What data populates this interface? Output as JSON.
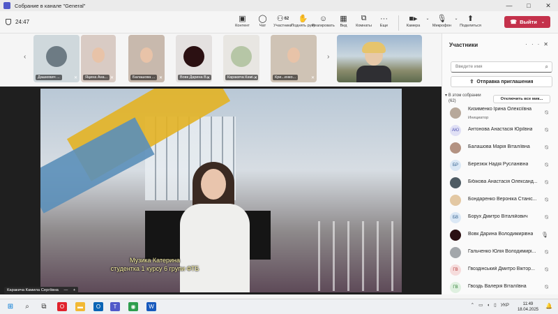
{
  "window": {
    "title": "Собрание в канале \"General\"",
    "controls": [
      "—",
      "□",
      "✕"
    ]
  },
  "toolbar": {
    "timer": "24:47",
    "buttons": [
      {
        "label": "Контент",
        "icon": "share-content-icon"
      },
      {
        "label": "Чат",
        "icon": "chat-icon"
      },
      {
        "label": "Участники",
        "icon": "participants-icon",
        "count": "62"
      },
      {
        "label": "Поднять руку",
        "icon": "raise-hand-icon"
      },
      {
        "label": "Реагировать",
        "icon": "react-icon"
      },
      {
        "label": "Вид",
        "icon": "view-icon"
      },
      {
        "label": "Комнаты",
        "icon": "rooms-icon"
      },
      {
        "label": "Еще",
        "icon": "more-icon"
      }
    ],
    "devices": [
      {
        "label": "Камера",
        "icon": "camera-icon"
      },
      {
        "label": "Микрофон",
        "icon": "microphone-off-icon"
      },
      {
        "label": "Поделиться",
        "icon": "share-icon"
      }
    ],
    "leave_label": "Выйти"
  },
  "strip": {
    "tiles": [
      {
        "name": "Дашкевич ...",
        "bg": "#cfd8dc",
        "circle": "#6d7b84"
      },
      {
        "name": "Яцина Ана...",
        "bg": "#d9cbc4",
        "circle": ""
      },
      {
        "name": "Балашова ...",
        "bg": "#c8b9ad",
        "circle": ""
      },
      {
        "name": "Вовк Дарина В...",
        "bg": "#e4e1e0",
        "circle": "#2b1012"
      },
      {
        "name": "Каракича Камі...",
        "bg": "#e8e6e2",
        "circle": "#b6c6a6"
      },
      {
        "name": "Кри...енко...",
        "bg": "#cfc3b5",
        "circle": ""
      }
    ]
  },
  "stage": {
    "caption_line1": "Музика Катерина",
    "caption_line2": "студентка 1 курсу 6 групи ФТБ",
    "speaker": "Каракича Камила Сергіївна"
  },
  "panel": {
    "title": "Участники",
    "search_placeholder": "Введите имя",
    "invite_label": "Отправка приглашения",
    "section_line1": "В этом собрании",
    "section_line2": "(62)",
    "mute_all": "Отключить все мик...",
    "participants": [
      {
        "name": "Кизименко Ірина Олексіївна",
        "role": "Инициатор",
        "initials": "",
        "av_bg": "#b7a89a",
        "av_fg": "#333",
        "mic": "off"
      },
      {
        "name": "Антонова Анастасія Юріївна",
        "role": "",
        "initials": "АЮ",
        "av_bg": "#e0e0f5",
        "av_fg": "#4f52b2",
        "mic": "off"
      },
      {
        "name": "Балашова Марія Віталіївна",
        "role": "",
        "initials": "",
        "av_bg": "#b39282",
        "av_fg": "#333",
        "mic": "off"
      },
      {
        "name": "Березюк Надія Русланівна",
        "role": "",
        "initials": "БР",
        "av_bg": "#dbe8f5",
        "av_fg": "#2d5c8a",
        "mic": "off"
      },
      {
        "name": "Бібікова Анастасія Олександ...",
        "role": "",
        "initials": "",
        "av_bg": "#4e5b63",
        "av_fg": "#fff",
        "mic": "off"
      },
      {
        "name": "Бондаренко Вероніка Станіс...",
        "role": "",
        "initials": "",
        "av_bg": "#e3c8a3",
        "av_fg": "#333",
        "mic": "off"
      },
      {
        "name": "Борух Дмитро Віталійович",
        "role": "",
        "initials": "БВ",
        "av_bg": "#dbe8f5",
        "av_fg": "#2d5c8a",
        "mic": "off"
      },
      {
        "name": "Вовк Дарина Володимирівна",
        "role": "",
        "initials": "",
        "av_bg": "#2b1012",
        "av_fg": "#fff",
        "mic": "on"
      },
      {
        "name": "Гальченко Юлія Володимирі...",
        "role": "",
        "initials": "",
        "av_bg": "#a3a7ab",
        "av_fg": "#333",
        "mic": "off"
      },
      {
        "name": "Гвоздінський Дмитро Віктор...",
        "role": "",
        "initials": "ГВ",
        "av_bg": "#f6dcdc",
        "av_fg": "#b33a3a",
        "mic": "off"
      },
      {
        "name": "Гвоздь Валерія Віталіївна",
        "role": "",
        "initials": "ГВ",
        "av_bg": "#dff0e0",
        "av_fg": "#2e7d32",
        "mic": "off"
      }
    ]
  },
  "taskbar": {
    "apps": [
      {
        "icon": "windows-start-icon",
        "color": "#0078d4"
      },
      {
        "icon": "search-icon",
        "color": "#333"
      },
      {
        "icon": "task-view-icon",
        "color": "#333"
      },
      {
        "icon": "opera-icon",
        "color": "#e0232d"
      },
      {
        "icon": "file-explorer-icon",
        "color": "#f2b935"
      },
      {
        "icon": "outlook-icon",
        "color": "#0a64b5"
      },
      {
        "icon": "teams-icon",
        "color": "#5059c9"
      },
      {
        "icon": "chrome-icon",
        "color": "#2e9e4e"
      },
      {
        "icon": "word-icon",
        "color": "#185abd"
      }
    ],
    "lang": "УКР",
    "time": "11:49",
    "date": "18.04.2025"
  }
}
